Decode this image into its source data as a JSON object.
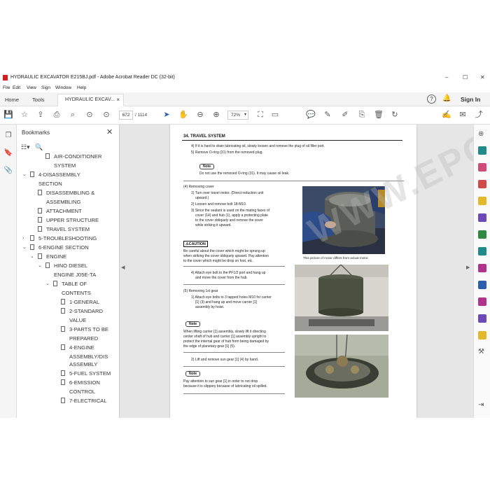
{
  "window": {
    "title": "HYDRAULIC EXCAVATOR E215BJ.pdf - Adobe Acrobat Reader DC (32-bit)",
    "controls": [
      "–",
      "☐",
      "✕"
    ]
  },
  "menu": [
    "File",
    "Edit",
    "View",
    "Sign",
    "Window",
    "Help"
  ],
  "tabs": {
    "home": "Home",
    "tools": "Tools",
    "document": "HYDRAULIC EXCAV...",
    "close": "×",
    "help": "?",
    "signin": "Sign In"
  },
  "toolbar": {
    "page_current": "672",
    "page_total": "/ 1114",
    "zoom": "72%"
  },
  "bookmarks": {
    "header": "Bookmarks",
    "close": "✕",
    "items": [
      {
        "label": "AIR-CONDITIONER",
        "indent": 3,
        "toggle": ""
      },
      {
        "label": "SYSTEM",
        "indent": 3,
        "toggle": "",
        "cont": true
      },
      {
        "label": "4-DISASSEMBLY",
        "indent": 1,
        "toggle": "⌄"
      },
      {
        "label": "SECTION",
        "indent": 1,
        "toggle": "",
        "cont": true
      },
      {
        "label": "DISASSEMBLING &",
        "indent": 2,
        "toggle": ""
      },
      {
        "label": "ASSEMBLING",
        "indent": 2,
        "toggle": "",
        "cont": true
      },
      {
        "label": "ATTACHMENT",
        "indent": 2,
        "toggle": ""
      },
      {
        "label": "UPPER STRUCTURE",
        "indent": 2,
        "toggle": ""
      },
      {
        "label": "TRAVEL SYSTEM",
        "indent": 2,
        "toggle": ""
      },
      {
        "label": "5-TROUBLESHOOTING",
        "indent": 1,
        "toggle": "›"
      },
      {
        "label": "6-ENGINE SECTION",
        "indent": 1,
        "toggle": "⌄"
      },
      {
        "label": "ENGINE",
        "indent": 2,
        "toggle": "⌄"
      },
      {
        "label": "HINO DIESEL",
        "indent": 3,
        "toggle": "⌄"
      },
      {
        "label": "ENGINE J05E-TA",
        "indent": 3,
        "toggle": "",
        "cont": true
      },
      {
        "label": "TABLE OF",
        "indent": 4,
        "toggle": "⌄"
      },
      {
        "label": "CONTENTS",
        "indent": 4,
        "toggle": "",
        "cont": true
      },
      {
        "label": "1-GENERAL",
        "indent": 5,
        "toggle": ""
      },
      {
        "label": "2-STANDARD",
        "indent": 5,
        "toggle": ""
      },
      {
        "label": "VALUE",
        "indent": 5,
        "toggle": "",
        "cont": true
      },
      {
        "label": "3-PARTS TO BE",
        "indent": 5,
        "toggle": ""
      },
      {
        "label": "PREPARED",
        "indent": 5,
        "toggle": "",
        "cont": true
      },
      {
        "label": "4-ENGINE",
        "indent": 5,
        "toggle": ""
      },
      {
        "label": "ASSEMBLY/DIS",
        "indent": 5,
        "toggle": "",
        "cont": true
      },
      {
        "label": "ASSEMBLY",
        "indent": 5,
        "toggle": "",
        "cont": true
      },
      {
        "label": "5-FUEL SYSTEM",
        "indent": 5,
        "toggle": ""
      },
      {
        "label": "6-EMISSION",
        "indent": 5,
        "toggle": ""
      },
      {
        "label": "CONTROL",
        "indent": 5,
        "toggle": "",
        "cont": true
      },
      {
        "label": "7-ELECTRICAL",
        "indent": 5,
        "toggle": ""
      }
    ]
  },
  "page": {
    "header": "34. TRAVEL SYSTEM",
    "step4": "4)   If it is hard to drain lubricating oil, slowly loosen and remove the plug of oil filler port.",
    "step5": "5)   Remove O-ring (31) from the removed plug.",
    "note_label": "Note",
    "note1": "Do not use the removed O-ring (31). It may cause oil leak.",
    "rc_title": "(4)  Removing cover",
    "rc1a": "1)  Turn over travel motor. (Direct reduction unit",
    "rc1b": "upward.)",
    "rc2": "2)  Loosen and remove bolt 18-M10.",
    "rc3a": "3)  Since the sealant is used on the mating faces of",
    "rc3b": "cover (14) and hub (1), apply a protecting plate",
    "rc3c": "to the cover obliquely and remove the cover",
    "rc3d": "while striking it upward.",
    "caution_label": "CAUTION",
    "caution1": "Be careful about the cover which might be sprung up",
    "caution2": "when striking the cover obliquely upward. Pay attention",
    "caution3": "to the cover which might be drop on foot, etc.",
    "rc4a": "4)  Attach eye bolt to the PF1/2 port and hang up",
    "rc4b": "and move the cover from the hub.",
    "photo1_caption": "This picture of motor differs from actual motor.",
    "g5_title": "(5)  Removing 1st gear",
    "g5_1a": "1)  Attach eye bolts to 3 tapped holes M10 for carrier",
    "g5_1b": "[1] (3) and hang up and move carrier [1]",
    "g5_1c": "assembly by hoist.",
    "note2_1": "When lifting carrier [1] assembly, slowly lift it directing",
    "note2_2": "center shaft of hub and carrier [1] assembly upright to",
    "note2_3": "protect the internal gear of hub from being damaged by",
    "note2_4": "the edge of planetary gear [1] (5).",
    "g5_2": "2)  Lift and remove sun gear [1] (4) by hand.",
    "note3_1": "Pay attention to sun gear [1] in order to not drop",
    "note3_2": "because it is slippery because of lubricating oil spilled."
  },
  "watermark": "WWW.EPCDEPO.COM",
  "colors": {
    "accent": "#2b5fae",
    "titlebar_icon": "#d21f1f",
    "viewer_bg": "#e6e6e6"
  }
}
